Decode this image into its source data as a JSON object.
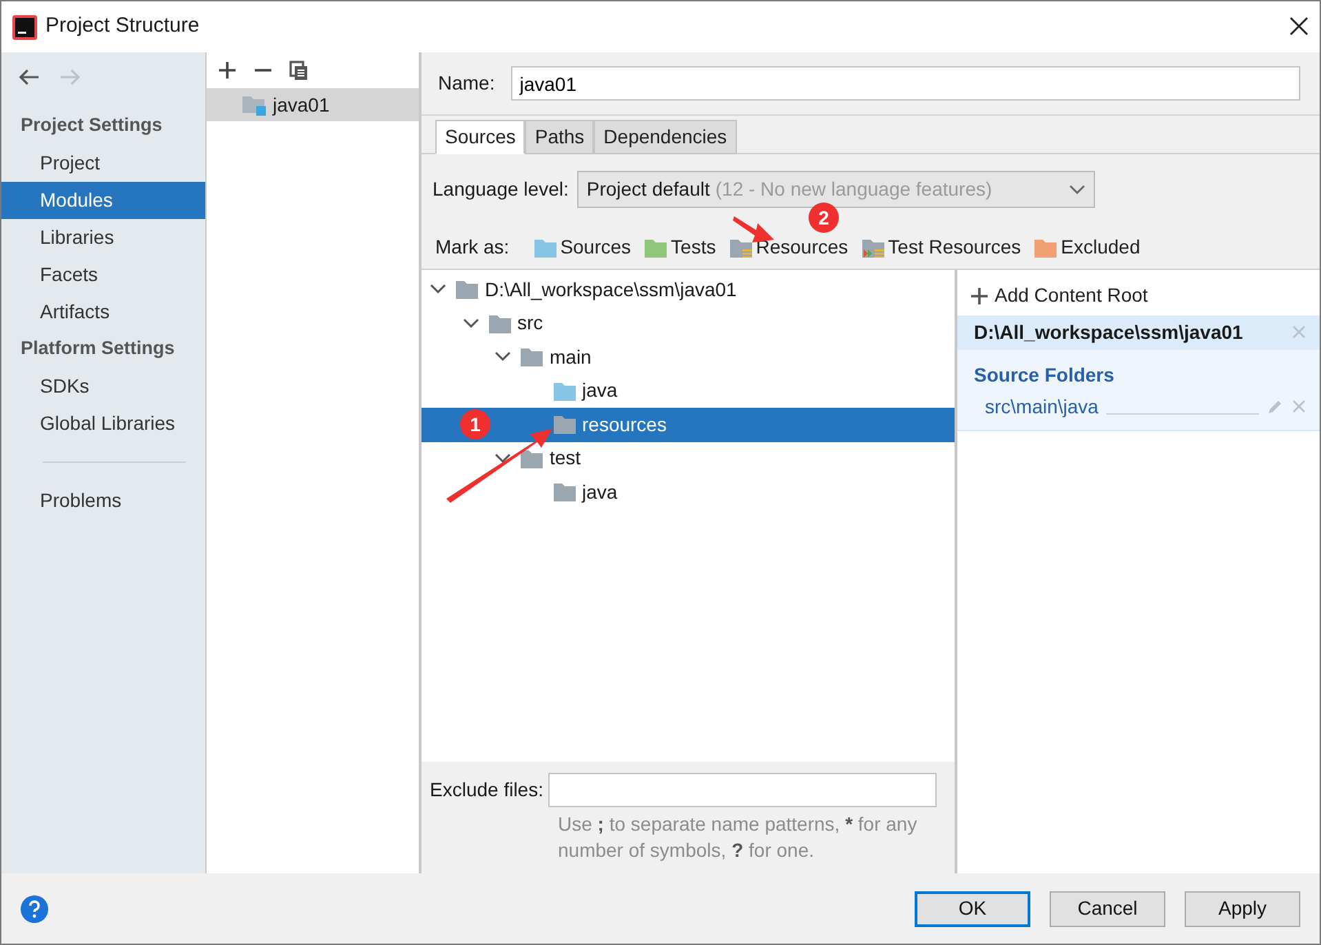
{
  "window": {
    "title": "Project Structure"
  },
  "history": {
    "back": {
      "disabled": false
    },
    "forward": {
      "disabled": true
    }
  },
  "sidebar": {
    "sections": [
      {
        "heading": "Project Settings",
        "items": [
          {
            "label": "Project",
            "selected": false
          },
          {
            "label": "Modules",
            "selected": true
          },
          {
            "label": "Libraries",
            "selected": false
          },
          {
            "label": "Facets",
            "selected": false
          },
          {
            "label": "Artifacts",
            "selected": false
          }
        ]
      },
      {
        "heading": "Platform Settings",
        "items": [
          {
            "label": "SDKs",
            "selected": false
          },
          {
            "label": "Global Libraries",
            "selected": false
          }
        ]
      }
    ],
    "extra_items": [
      {
        "label": "Problems",
        "selected": false
      }
    ]
  },
  "modules": {
    "items": [
      {
        "label": "java01",
        "selected": true
      }
    ]
  },
  "name_field": {
    "label": "Name:",
    "value": "java01"
  },
  "tabs": [
    {
      "label": "Sources",
      "selected": true
    },
    {
      "label": "Paths",
      "selected": false
    },
    {
      "label": "Dependencies",
      "selected": false
    }
  ],
  "language_level": {
    "label": "Language level:",
    "value": "Project default",
    "detail": "(12 - No new language features)"
  },
  "mark_as": {
    "label": "Mark as:",
    "options": [
      {
        "label": "Sources",
        "kind": "sources"
      },
      {
        "label": "Tests",
        "kind": "tests"
      },
      {
        "label": "Resources",
        "kind": "resources"
      },
      {
        "label": "Test Resources",
        "kind": "test-resources"
      },
      {
        "label": "Excluded",
        "kind": "excluded"
      }
    ]
  },
  "tree": [
    {
      "label": "D:\\All_workspace\\ssm\\java01",
      "kind": "folder",
      "selected": false,
      "expanded": true,
      "children": [
        {
          "label": "src",
          "kind": "folder",
          "selected": false,
          "expanded": true,
          "children": [
            {
              "label": "main",
              "kind": "folder",
              "selected": false,
              "expanded": true,
              "children": [
                {
                  "label": "java",
                  "kind": "sources",
                  "selected": false
                },
                {
                  "label": "resources",
                  "kind": "folder",
                  "selected": true
                }
              ]
            },
            {
              "label": "test",
              "kind": "folder",
              "selected": false,
              "expanded": true,
              "children": [
                {
                  "label": "java",
                  "kind": "folder",
                  "selected": false
                }
              ]
            }
          ]
        }
      ]
    }
  ],
  "exclude": {
    "label": "Exclude files:",
    "hint": [
      {
        "text": "Use ",
        "bold": false
      },
      {
        "text": ";",
        "bold": true
      },
      {
        "text": " to separate name patterns, ",
        "bold": false
      },
      {
        "text": "*",
        "bold": true
      },
      {
        "text": " for any number of symbols, ",
        "bold": false
      },
      {
        "text": "?",
        "bold": true
      },
      {
        "text": " for one.",
        "bold": false
      }
    ]
  },
  "content_roots": {
    "add_label": "Add Content Root",
    "roots": [
      {
        "path": "D:\\All_workspace\\ssm\\java01",
        "selected": true,
        "groups": [
          {
            "heading": "Source Folders",
            "folders": [
              "src\\main\\java"
            ]
          }
        ]
      }
    ]
  },
  "buttons": [
    {
      "label": "OK",
      "default": true
    },
    {
      "label": "Cancel",
      "default": false
    },
    {
      "label": "Apply",
      "default": false
    }
  ],
  "annotations": [
    {
      "number": "1"
    },
    {
      "number": "2"
    }
  ]
}
